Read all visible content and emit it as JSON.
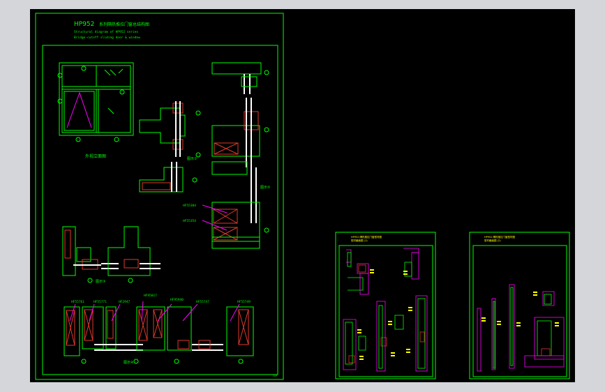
{
  "app": {
    "background_color": "#d4d6da",
    "model_space_color": "#000000",
    "line_colors": {
      "frame": "#00ff00",
      "profile_red": "#e0392b",
      "accent_magenta": "#ff00ff",
      "glass_white": "#ffffff",
      "dim_cyan": "#00ffff",
      "text_yellow": "#ffff00"
    }
  },
  "sheet_main": {
    "title": "HP952",
    "title_cn": "系列隔热推拉门窗总结构图",
    "subtitle_1": "Structural diagram of HP952 series",
    "subtitle_2": "Bridge-cutoff sliding door & window",
    "elevation_label": "外视立面图",
    "section_label_a": "图示①",
    "section_label_b": "图示②",
    "section_label_c": "图示③",
    "section_label_d": "图示④",
    "callouts_mid": [
      "HF55384",
      "HF55354"
    ],
    "callouts_bottom": [
      "HF55761",
      "HF55771",
      "HF2947",
      "HF95017",
      "HF95940",
      "HF55747",
      "HF55749"
    ],
    "corner_mark": "TSP"
  },
  "sheet_b": {
    "header_1": "HP952 隔热推拉门窗型材图",
    "header_2": "型材截面图 (1)"
  },
  "sheet_c": {
    "header_1": "HP952 隔热推拉门窗型材图",
    "header_2": "型材截面图 (2)"
  }
}
